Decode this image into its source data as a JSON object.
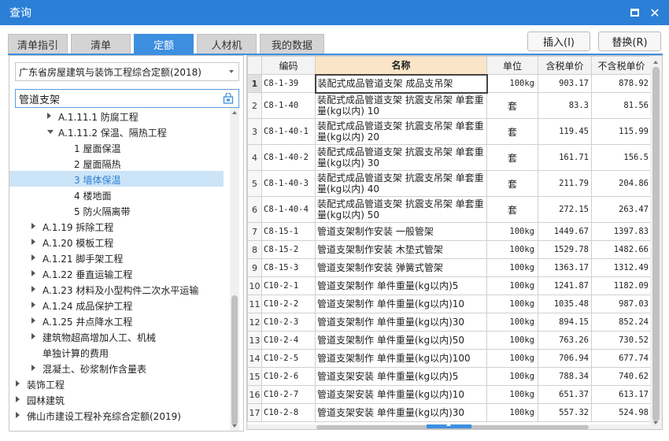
{
  "window": {
    "title": "查询",
    "maximize_icon": "maximize-icon",
    "close_icon": "close-icon",
    "accent": "#2b7fd6"
  },
  "tabs": [
    {
      "label": "清单指引"
    },
    {
      "label": "清单"
    },
    {
      "label": "定额",
      "active": true
    },
    {
      "label": "人材机"
    },
    {
      "label": "我的数据"
    }
  ],
  "buttons": {
    "insert": "插入(I)",
    "replace": "替换(R)"
  },
  "left": {
    "library": "广东省房屋建筑与装饰工程综合定额(2018)",
    "search_value": "管道支架",
    "tree": [
      {
        "label": "A.1.11.1 防腐工程",
        "arrow": "right",
        "level": 3
      },
      {
        "label": "A.1.11.2 保温、隔热工程",
        "arrow": "down",
        "level": 3
      },
      {
        "label": "1 屋面保温",
        "arrow": "",
        "level": 4
      },
      {
        "label": "2 屋面隔热",
        "arrow": "",
        "level": 4
      },
      {
        "label": "3 墙体保温",
        "arrow": "",
        "level": 4,
        "selected": true
      },
      {
        "label": "4 楼地面",
        "arrow": "",
        "level": 4
      },
      {
        "label": "5 防火隔离带",
        "arrow": "",
        "level": 4
      },
      {
        "label": "A.1.19 拆除工程",
        "arrow": "right",
        "level": 2
      },
      {
        "label": "A.1.20 模板工程",
        "arrow": "right",
        "level": 2
      },
      {
        "label": "A.1.21 脚手架工程",
        "arrow": "right",
        "level": 2
      },
      {
        "label": "A.1.22 垂直运输工程",
        "arrow": "right",
        "level": 2
      },
      {
        "label": "A.1.23 材料及小型构件二次水平运输",
        "arrow": "right",
        "level": 2
      },
      {
        "label": "A.1.24 成品保护工程",
        "arrow": "right",
        "level": 2
      },
      {
        "label": "A.1.25 井点降水工程",
        "arrow": "right",
        "level": 2
      },
      {
        "label": "建筑物超高增加人工、机械",
        "arrow": "right",
        "level": 2
      },
      {
        "label": "单独计算的费用",
        "arrow": "",
        "level": 2
      },
      {
        "label": "混凝土、砂浆制作含量表",
        "arrow": "right",
        "level": 2
      },
      {
        "label": "装饰工程",
        "arrow": "right",
        "level": 1
      },
      {
        "label": "园林建筑",
        "arrow": "right",
        "level": 1
      },
      {
        "label": "佛山市建设工程补充综合定额(2019)",
        "arrow": "right",
        "level": 1
      }
    ]
  },
  "table": {
    "columns": [
      "",
      "编码",
      "名称",
      "单位",
      "含税单价",
      "不含税单价"
    ],
    "rows": [
      {
        "idx": "1",
        "code": "C8-1-39",
        "name": "装配式成品管道支架 成品支吊架",
        "unit": "100kg",
        "tax": "903.17",
        "notax": "878.92"
      },
      {
        "idx": "2",
        "code": "C8-1-40",
        "name": "装配式成品管道支架 抗震支吊架 单套重量(kg以内) 10",
        "unit": "套",
        "tax": "83.3",
        "notax": "81.56"
      },
      {
        "idx": "3",
        "code": "C8-1-40-1",
        "name": "装配式成品管道支架 抗震支吊架 单套重量(kg以内) 20",
        "unit": "套",
        "tax": "119.45",
        "notax": "115.99"
      },
      {
        "idx": "4",
        "code": "C8-1-40-2",
        "name": "装配式成品管道支架 抗震支吊架 单套重量(kg以内) 30",
        "unit": "套",
        "tax": "161.71",
        "notax": "156.5"
      },
      {
        "idx": "5",
        "code": "C8-1-40-3",
        "name": "装配式成品管道支架 抗震支吊架 单套重量(kg以内) 40",
        "unit": "套",
        "tax": "211.79",
        "notax": "204.86"
      },
      {
        "idx": "6",
        "code": "C8-1-40-4",
        "name": "装配式成品管道支架 抗震支吊架 单套重量(kg以内) 50",
        "unit": "套",
        "tax": "272.15",
        "notax": "263.47"
      },
      {
        "idx": "7",
        "code": "C8-15-1",
        "name": "管道支架制作安装 一般管架",
        "unit": "100kg",
        "tax": "1449.67",
        "notax": "1397.83"
      },
      {
        "idx": "8",
        "code": "C8-15-2",
        "name": "管道支架制作安装 木垫式管架",
        "unit": "100kg",
        "tax": "1529.78",
        "notax": "1482.66"
      },
      {
        "idx": "9",
        "code": "C8-15-3",
        "name": "管道支架制作安装 弹簧式管架",
        "unit": "100kg",
        "tax": "1363.17",
        "notax": "1312.49"
      },
      {
        "idx": "10",
        "code": "C10-2-1",
        "name": "管道支架制作 单件重量(kg以内)5",
        "unit": "100kg",
        "tax": "1241.87",
        "notax": "1182.09"
      },
      {
        "idx": "11",
        "code": "C10-2-2",
        "name": "管道支架制作 单件重量(kg以内)10",
        "unit": "100kg",
        "tax": "1035.48",
        "notax": "987.03"
      },
      {
        "idx": "12",
        "code": "C10-2-3",
        "name": "管道支架制作 单件重量(kg以内)30",
        "unit": "100kg",
        "tax": "894.15",
        "notax": "852.24"
      },
      {
        "idx": "13",
        "code": "C10-2-4",
        "name": "管道支架制作 单件重量(kg以内)50",
        "unit": "100kg",
        "tax": "763.26",
        "notax": "730.52"
      },
      {
        "idx": "14",
        "code": "C10-2-5",
        "name": "管道支架制作 单件重量(kg以内)100",
        "unit": "100kg",
        "tax": "706.94",
        "notax": "677.74"
      },
      {
        "idx": "15",
        "code": "C10-2-6",
        "name": "管道支架安装 单件重量(kg以内)5",
        "unit": "100kg",
        "tax": "788.34",
        "notax": "740.62"
      },
      {
        "idx": "16",
        "code": "C10-2-7",
        "name": "管道支架安装 单件重量(kg以内)10",
        "unit": "100kg",
        "tax": "651.37",
        "notax": "613.17"
      },
      {
        "idx": "17",
        "code": "C10-2-8",
        "name": "管道支架安装 单件重量(kg以内)30",
        "unit": "100kg",
        "tax": "557.32",
        "notax": "524.98"
      }
    ]
  }
}
